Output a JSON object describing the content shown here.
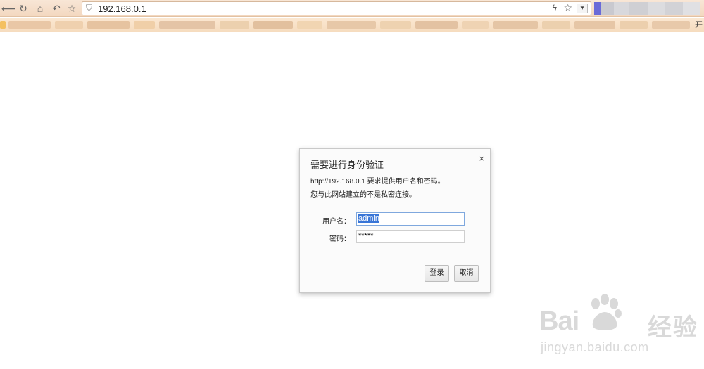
{
  "browser": {
    "url": "192.168.0.1",
    "bookmark_end_text": "开"
  },
  "icons": {
    "back": "back-arrow-icon",
    "reload": "reload-icon",
    "home": "home-icon",
    "undo": "undo-icon",
    "favorite": "star-icon",
    "shield": "shield-icon",
    "lightning": "lightning-icon",
    "bookmark_star": "star-icon",
    "dropdown": "chevron-down-icon",
    "close": "close-icon"
  },
  "dialog": {
    "title": "需要进行身份验证",
    "message_line1": "http://192.168.0.1 要求提供用户名和密码。",
    "message_line2": "您与此网站建立的不是私密连接。",
    "username_label": "用户名：",
    "username_value": "admin",
    "password_label": "密码：",
    "password_value": "*****",
    "login_button": "登录",
    "cancel_button": "取消",
    "close_glyph": "×"
  },
  "watermark": {
    "brand_left": "Bai",
    "brand_paw": "du",
    "brand_right": "经验",
    "site": "jingyan.baidu.com"
  },
  "colors": {
    "toolbar": "#f3d8c0",
    "selection": "#3875d7",
    "focus_border": "#7fa8de"
  }
}
